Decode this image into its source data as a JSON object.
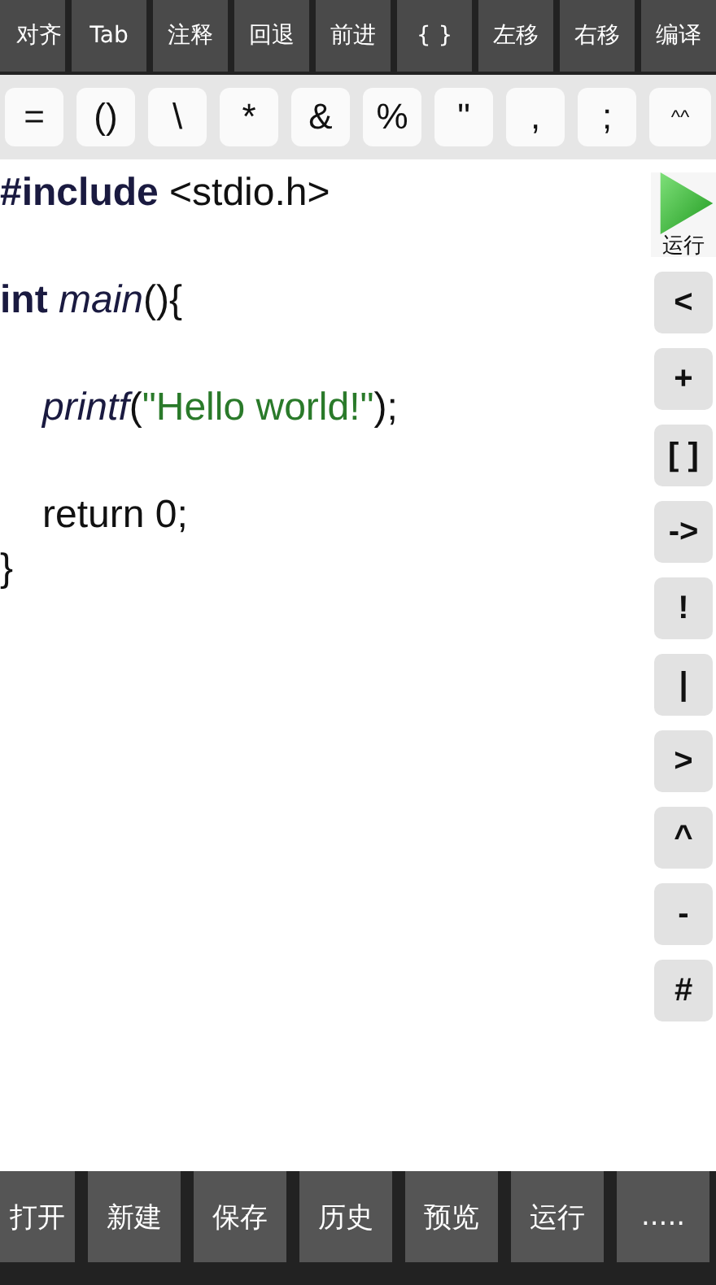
{
  "top_toolbar": [
    "对齐",
    "Tab",
    "注释",
    "回退",
    "前进",
    "{ }",
    "左移",
    "右移",
    "编译"
  ],
  "symbol_keys": [
    "=",
    "()",
    "\\",
    "*",
    "&",
    "%",
    "\"",
    ",",
    ";",
    "^^"
  ],
  "code_lines": [
    {
      "tokens": [
        {
          "kind": "directive",
          "text": "#include"
        },
        {
          "kind": "plain",
          "text": " <stdio.h>"
        }
      ]
    },
    {
      "kind": "blank"
    },
    {
      "kind": "code",
      "tokens": [
        {
          "kind": "keyword",
          "text": "int "
        },
        {
          "kind": "function",
          "text": "main"
        },
        {
          "kind": "plain",
          "text": "(){"
        }
      ]
    },
    {
      "kind": "blank"
    },
    {
      "indented": true,
      "tokens": [
        {
          "kind": "function",
          "text": "printf"
        },
        {
          "kind": "plain",
          "text": "("
        },
        {
          "kind": "string",
          "text": "\"Hello world!\""
        },
        {
          "kind": "plain",
          "text": ");"
        }
      ]
    },
    {
      "kind": "blank"
    },
    {
      "indented": true,
      "tokens": [
        {
          "kind": "plain",
          "text": "return 0;"
        }
      ]
    },
    {
      "tokens": [
        {
          "kind": "plain",
          "text": "}"
        }
      ]
    }
  ],
  "run_button": {
    "label": "运行"
  },
  "side_keys": [
    "<",
    "+",
    "[ ]",
    "->",
    "!",
    "|",
    ">",
    "^",
    "-",
    "#"
  ],
  "bottom_toolbar": [
    "打开",
    "新建",
    "保存",
    "历史",
    "预览",
    "运行",
    "....."
  ]
}
